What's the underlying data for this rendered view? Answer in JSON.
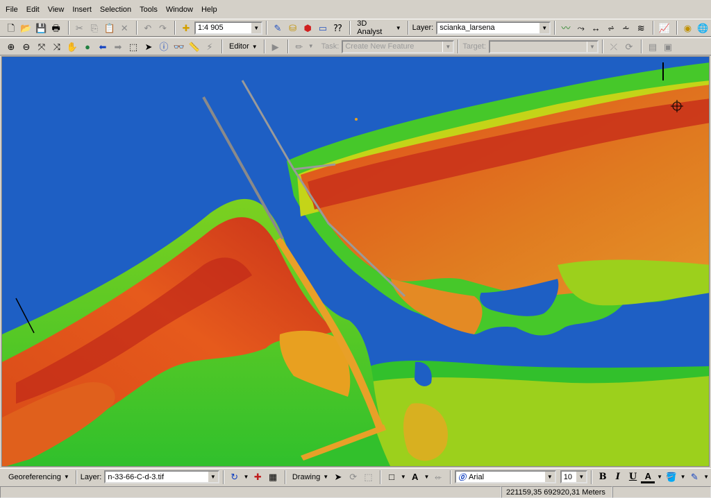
{
  "menu": [
    "File",
    "Edit",
    "View",
    "Insert",
    "Selection",
    "Tools",
    "Window",
    "Help"
  ],
  "toolbar1": {
    "scale_value": "1:4 905",
    "analyst_label": "3D Analyst",
    "layer_label": "Layer:",
    "layer_value": "scianka_larsena"
  },
  "toolbar2": {
    "editor_label": "Editor",
    "task_label": "Task:",
    "task_value": "Create New Feature",
    "target_label": "Target:",
    "target_value": ""
  },
  "bottom_toolbar": {
    "georef_label": "Georeferencing",
    "layer_label": "Layer:",
    "layer_value": "n-33-66-C-d-3.tif",
    "drawing_label": "Drawing",
    "text_tool": "A",
    "font_name": "Arial",
    "font_size": "10",
    "bold": "B",
    "italic": "I",
    "underline": "U",
    "font_color": "A"
  },
  "status": {
    "coordinates": "221159,35  692920,31 Meters"
  },
  "colors": {
    "water": "#1e5fc4",
    "low": "#34c22e",
    "mid": "#b8d41a",
    "high": "#e2561a",
    "peak": "#c8301a"
  }
}
